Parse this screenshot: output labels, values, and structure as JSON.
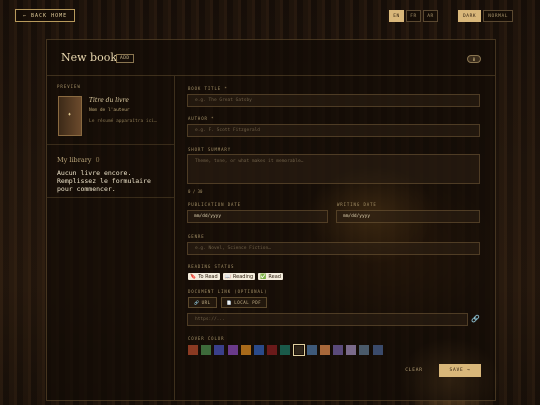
{
  "topbar": {
    "back_label": "← BACK HOME",
    "languages": [
      "EN",
      "FR",
      "AR"
    ],
    "active_language": "EN",
    "themes": [
      "DARK",
      "NORMAL"
    ],
    "active_theme": "DARK"
  },
  "panel": {
    "title": "New book",
    "badge": "ADD",
    "count_pill": "0"
  },
  "preview": {
    "label": "PREVIEW",
    "cover_glyph": "♦",
    "title": "Titre du livre",
    "author": "Nom de l'auteur",
    "summary": "Le résumé apparaîtra ici…"
  },
  "library": {
    "title": "My library",
    "count": "0",
    "empty_message": "Aucun livre encore. Remplissez le formulaire pour commencer."
  },
  "form": {
    "title_label": "BOOK TITLE *",
    "title_placeholder": "e.g. The Great Gatsby",
    "author_label": "AUTHOR *",
    "author_placeholder": "e.g. F. Scott Fitzgerald",
    "summary_label": "SHORT SUMMARY",
    "summary_placeholder": "Theme, tone, or what makes it memorable…",
    "summary_counter": "0 / 30",
    "pub_date_label": "PUBLICATION DATE",
    "pub_date_value": "mm/dd/yyyy",
    "writing_date_label": "WRITING DATE",
    "writing_date_value": "mm/dd/yyyy",
    "genre_label": "GENRE",
    "genre_placeholder": "e.g. Novel, Science Fiction…",
    "status_label": "READING STATUS",
    "statuses": [
      {
        "icon": "🔖",
        "label": "To Read"
      },
      {
        "icon": "📖",
        "label": "Reading"
      },
      {
        "icon": "✅",
        "label": "Read"
      }
    ],
    "doc_label": "DOCUMENT LINK (OPTIONAL)",
    "url_button": "URL",
    "pdf_button": "LOCAL PDF",
    "url_placeholder": "https://...",
    "color_label": "COVER COLOR",
    "colors": [
      "#8a3a22",
      "#3d6a3a",
      "#3a3f8a",
      "#6a3a8a",
      "#a86a1a",
      "#2a4a8a",
      "#6a1a1a",
      "#1a5a4a",
      "#2e2418",
      "#3e5a7a",
      "#a8683a",
      "#5a4a7a",
      "#7a6a8a",
      "#4a5a6a",
      "#3a4a6a"
    ],
    "selected_color": "#2e2418",
    "clear_label": "CLEAR",
    "save_label": "SAVE →"
  }
}
